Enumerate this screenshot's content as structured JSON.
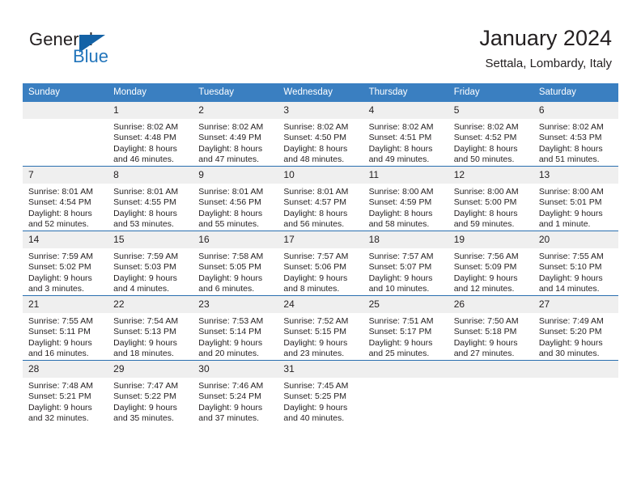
{
  "logo": {
    "word_general": "General",
    "word_blue": "Blue",
    "triangle_color": "#1462a6",
    "blue_text_color": "#2275bb"
  },
  "header": {
    "title": "January 2024",
    "subtitle": "Settala, Lombardy, Italy",
    "header_bg_color": "#3a7fc1",
    "daynum_bg_color": "#efefef",
    "row_divider_color": "#2a6fb0"
  },
  "weekday_headers": [
    "Sunday",
    "Monday",
    "Tuesday",
    "Wednesday",
    "Thursday",
    "Friday",
    "Saturday"
  ],
  "weeks": [
    [
      {
        "day": "",
        "sunrise": "",
        "sunset": "",
        "daylight_line1": "",
        "daylight_line2": ""
      },
      {
        "day": "1",
        "sunrise": "Sunrise: 8:02 AM",
        "sunset": "Sunset: 4:48 PM",
        "daylight_line1": "Daylight: 8 hours",
        "daylight_line2": "and 46 minutes."
      },
      {
        "day": "2",
        "sunrise": "Sunrise: 8:02 AM",
        "sunset": "Sunset: 4:49 PM",
        "daylight_line1": "Daylight: 8 hours",
        "daylight_line2": "and 47 minutes."
      },
      {
        "day": "3",
        "sunrise": "Sunrise: 8:02 AM",
        "sunset": "Sunset: 4:50 PM",
        "daylight_line1": "Daylight: 8 hours",
        "daylight_line2": "and 48 minutes."
      },
      {
        "day": "4",
        "sunrise": "Sunrise: 8:02 AM",
        "sunset": "Sunset: 4:51 PM",
        "daylight_line1": "Daylight: 8 hours",
        "daylight_line2": "and 49 minutes."
      },
      {
        "day": "5",
        "sunrise": "Sunrise: 8:02 AM",
        "sunset": "Sunset: 4:52 PM",
        "daylight_line1": "Daylight: 8 hours",
        "daylight_line2": "and 50 minutes."
      },
      {
        "day": "6",
        "sunrise": "Sunrise: 8:02 AM",
        "sunset": "Sunset: 4:53 PM",
        "daylight_line1": "Daylight: 8 hours",
        "daylight_line2": "and 51 minutes."
      }
    ],
    [
      {
        "day": "7",
        "sunrise": "Sunrise: 8:01 AM",
        "sunset": "Sunset: 4:54 PM",
        "daylight_line1": "Daylight: 8 hours",
        "daylight_line2": "and 52 minutes."
      },
      {
        "day": "8",
        "sunrise": "Sunrise: 8:01 AM",
        "sunset": "Sunset: 4:55 PM",
        "daylight_line1": "Daylight: 8 hours",
        "daylight_line2": "and 53 minutes."
      },
      {
        "day": "9",
        "sunrise": "Sunrise: 8:01 AM",
        "sunset": "Sunset: 4:56 PM",
        "daylight_line1": "Daylight: 8 hours",
        "daylight_line2": "and 55 minutes."
      },
      {
        "day": "10",
        "sunrise": "Sunrise: 8:01 AM",
        "sunset": "Sunset: 4:57 PM",
        "daylight_line1": "Daylight: 8 hours",
        "daylight_line2": "and 56 minutes."
      },
      {
        "day": "11",
        "sunrise": "Sunrise: 8:00 AM",
        "sunset": "Sunset: 4:59 PM",
        "daylight_line1": "Daylight: 8 hours",
        "daylight_line2": "and 58 minutes."
      },
      {
        "day": "12",
        "sunrise": "Sunrise: 8:00 AM",
        "sunset": "Sunset: 5:00 PM",
        "daylight_line1": "Daylight: 8 hours",
        "daylight_line2": "and 59 minutes."
      },
      {
        "day": "13",
        "sunrise": "Sunrise: 8:00 AM",
        "sunset": "Sunset: 5:01 PM",
        "daylight_line1": "Daylight: 9 hours",
        "daylight_line2": "and 1 minute."
      }
    ],
    [
      {
        "day": "14",
        "sunrise": "Sunrise: 7:59 AM",
        "sunset": "Sunset: 5:02 PM",
        "daylight_line1": "Daylight: 9 hours",
        "daylight_line2": "and 3 minutes."
      },
      {
        "day": "15",
        "sunrise": "Sunrise: 7:59 AM",
        "sunset": "Sunset: 5:03 PM",
        "daylight_line1": "Daylight: 9 hours",
        "daylight_line2": "and 4 minutes."
      },
      {
        "day": "16",
        "sunrise": "Sunrise: 7:58 AM",
        "sunset": "Sunset: 5:05 PM",
        "daylight_line1": "Daylight: 9 hours",
        "daylight_line2": "and 6 minutes."
      },
      {
        "day": "17",
        "sunrise": "Sunrise: 7:57 AM",
        "sunset": "Sunset: 5:06 PM",
        "daylight_line1": "Daylight: 9 hours",
        "daylight_line2": "and 8 minutes."
      },
      {
        "day": "18",
        "sunrise": "Sunrise: 7:57 AM",
        "sunset": "Sunset: 5:07 PM",
        "daylight_line1": "Daylight: 9 hours",
        "daylight_line2": "and 10 minutes."
      },
      {
        "day": "19",
        "sunrise": "Sunrise: 7:56 AM",
        "sunset": "Sunset: 5:09 PM",
        "daylight_line1": "Daylight: 9 hours",
        "daylight_line2": "and 12 minutes."
      },
      {
        "day": "20",
        "sunrise": "Sunrise: 7:55 AM",
        "sunset": "Sunset: 5:10 PM",
        "daylight_line1": "Daylight: 9 hours",
        "daylight_line2": "and 14 minutes."
      }
    ],
    [
      {
        "day": "21",
        "sunrise": "Sunrise: 7:55 AM",
        "sunset": "Sunset: 5:11 PM",
        "daylight_line1": "Daylight: 9 hours",
        "daylight_line2": "and 16 minutes."
      },
      {
        "day": "22",
        "sunrise": "Sunrise: 7:54 AM",
        "sunset": "Sunset: 5:13 PM",
        "daylight_line1": "Daylight: 9 hours",
        "daylight_line2": "and 18 minutes."
      },
      {
        "day": "23",
        "sunrise": "Sunrise: 7:53 AM",
        "sunset": "Sunset: 5:14 PM",
        "daylight_line1": "Daylight: 9 hours",
        "daylight_line2": "and 20 minutes."
      },
      {
        "day": "24",
        "sunrise": "Sunrise: 7:52 AM",
        "sunset": "Sunset: 5:15 PM",
        "daylight_line1": "Daylight: 9 hours",
        "daylight_line2": "and 23 minutes."
      },
      {
        "day": "25",
        "sunrise": "Sunrise: 7:51 AM",
        "sunset": "Sunset: 5:17 PM",
        "daylight_line1": "Daylight: 9 hours",
        "daylight_line2": "and 25 minutes."
      },
      {
        "day": "26",
        "sunrise": "Sunrise: 7:50 AM",
        "sunset": "Sunset: 5:18 PM",
        "daylight_line1": "Daylight: 9 hours",
        "daylight_line2": "and 27 minutes."
      },
      {
        "day": "27",
        "sunrise": "Sunrise: 7:49 AM",
        "sunset": "Sunset: 5:20 PM",
        "daylight_line1": "Daylight: 9 hours",
        "daylight_line2": "and 30 minutes."
      }
    ],
    [
      {
        "day": "28",
        "sunrise": "Sunrise: 7:48 AM",
        "sunset": "Sunset: 5:21 PM",
        "daylight_line1": "Daylight: 9 hours",
        "daylight_line2": "and 32 minutes."
      },
      {
        "day": "29",
        "sunrise": "Sunrise: 7:47 AM",
        "sunset": "Sunset: 5:22 PM",
        "daylight_line1": "Daylight: 9 hours",
        "daylight_line2": "and 35 minutes."
      },
      {
        "day": "30",
        "sunrise": "Sunrise: 7:46 AM",
        "sunset": "Sunset: 5:24 PM",
        "daylight_line1": "Daylight: 9 hours",
        "daylight_line2": "and 37 minutes."
      },
      {
        "day": "31",
        "sunrise": "Sunrise: 7:45 AM",
        "sunset": "Sunset: 5:25 PM",
        "daylight_line1": "Daylight: 9 hours",
        "daylight_line2": "and 40 minutes."
      },
      {
        "day": "",
        "sunrise": "",
        "sunset": "",
        "daylight_line1": "",
        "daylight_line2": ""
      },
      {
        "day": "",
        "sunrise": "",
        "sunset": "",
        "daylight_line1": "",
        "daylight_line2": ""
      },
      {
        "day": "",
        "sunrise": "",
        "sunset": "",
        "daylight_line1": "",
        "daylight_line2": ""
      }
    ]
  ]
}
